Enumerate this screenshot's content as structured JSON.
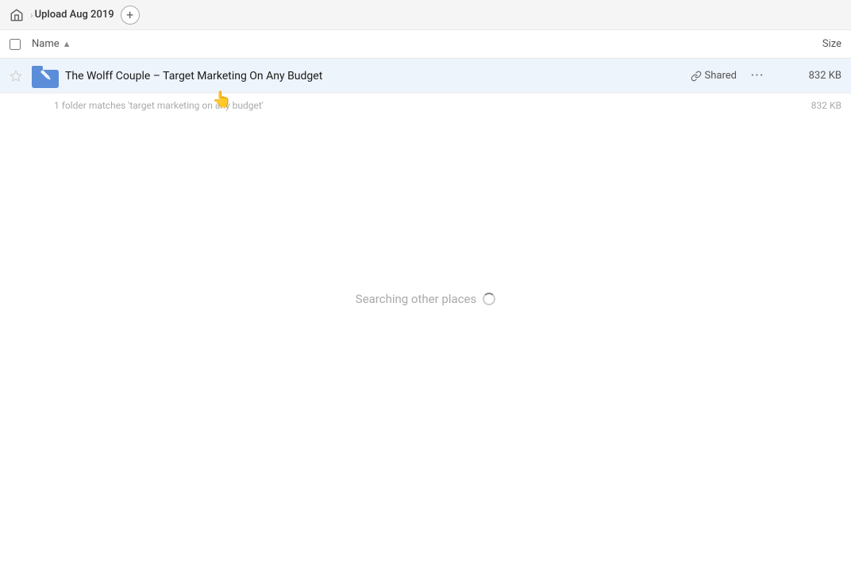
{
  "breadcrumb": {
    "home_label": "Home",
    "folder_label": "Upload Aug 2019",
    "add_btn_label": "+"
  },
  "columns": {
    "name_label": "Name",
    "sort_indicator": "▲",
    "size_label": "Size"
  },
  "file_row": {
    "name": "The Wolff Couple – Target Marketing On Any Budget",
    "shared_label": "Shared",
    "size": "832 KB",
    "more_icon": "•••"
  },
  "match_info": {
    "text": "1 folder matches 'target marketing on any budget'",
    "size": "832 KB"
  },
  "searching": {
    "text": "Searching other places"
  },
  "icons": {
    "home": "⌂",
    "star_empty": "☆",
    "link": "🔗",
    "more": "···",
    "sort_asc": "↑"
  }
}
